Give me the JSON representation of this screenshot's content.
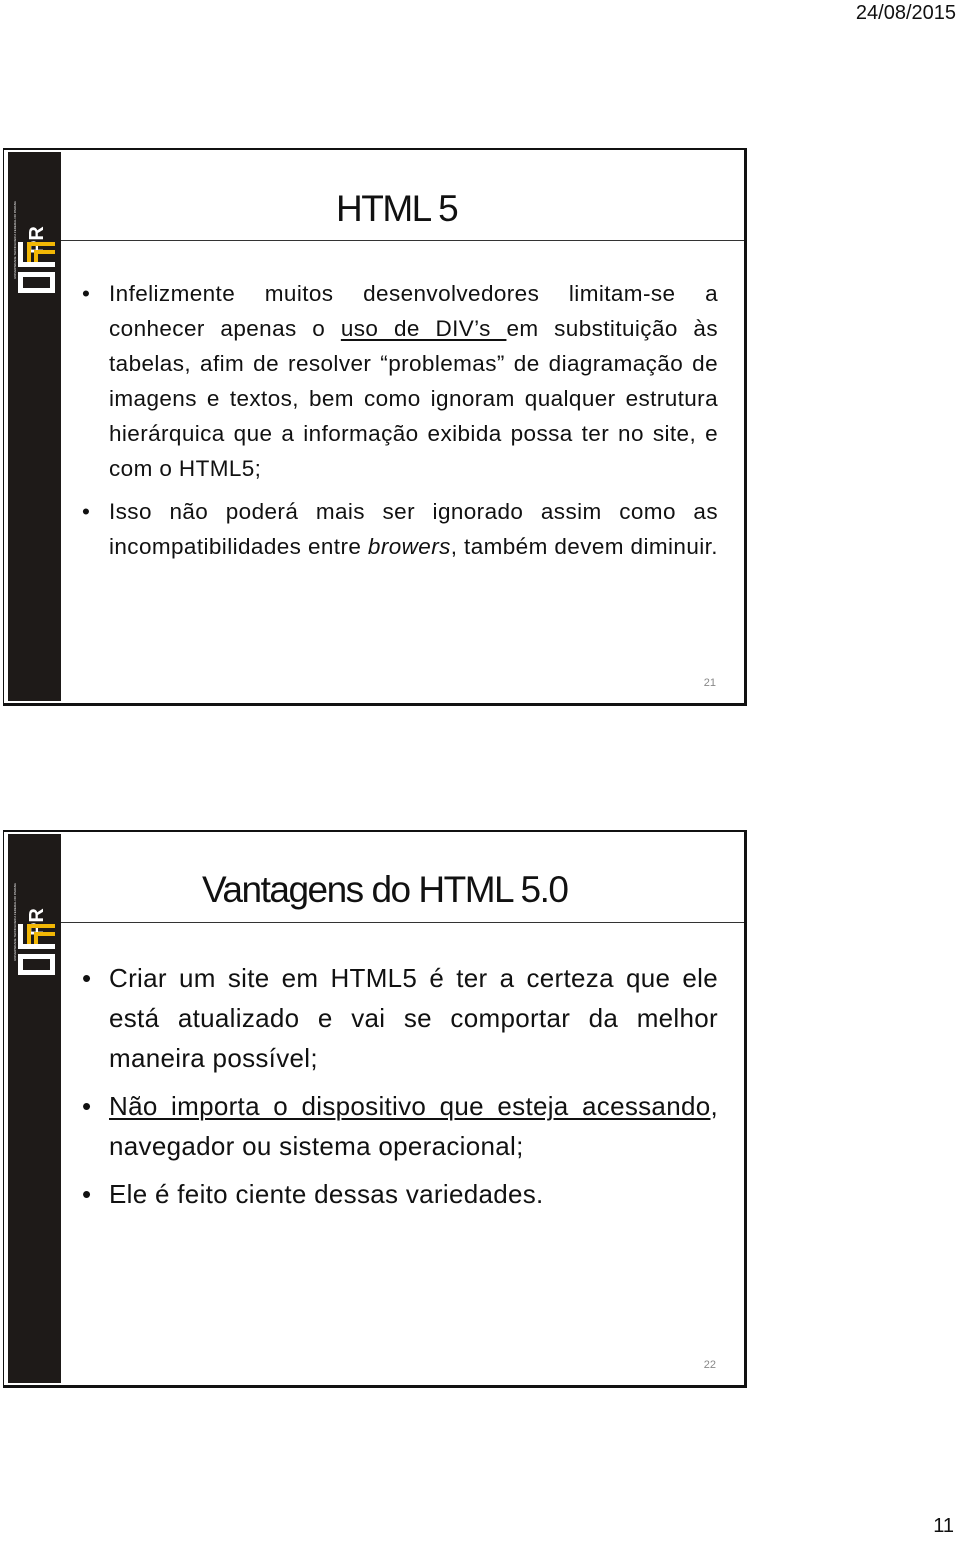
{
  "page": {
    "date": "24/08/2015",
    "page_number": "11"
  },
  "brand": {
    "logo_text": "UTFPR",
    "logo_subtext": "UNIVERSIDADE TECNOLÓGICA FEDERAL DO PARANÁ",
    "sidebar_color": "#1e1a18",
    "accent_color": "#f2b705"
  },
  "slides": [
    {
      "number": "21",
      "title": "HTML 5",
      "bullets": [
        {
          "parts": [
            {
              "text": " Infelizmente muitos desenvolvedores limitam-se a conhecer apenas o ",
              "style": "normal"
            },
            {
              "text": "uso de DIV’s ",
              "style": "underline"
            },
            {
              "text": "em substituição às tabelas, afim de resolver “problemas” de diagramação de imagens e textos, bem como ignoram qualquer estrutura hierárquica que a informação exibida possa ter no site, e com o HTML5;",
              "style": "normal"
            }
          ]
        },
        {
          "parts": [
            {
              "text": "Isso não poderá mais ser ignorado assim como as incompatibilidades entre ",
              "style": "normal"
            },
            {
              "text": "browers",
              "style": "italic"
            },
            {
              "text": ", também devem diminuir.",
              "style": "normal"
            }
          ]
        }
      ]
    },
    {
      "number": "22",
      "title": "Vantagens do HTML 5.0",
      "bullets": [
        {
          "parts": [
            {
              "text": "Criar um site em HTML5 é ter a certeza que ele está atualizado e vai se comportar da melhor maneira possível;",
              "style": "normal"
            }
          ]
        },
        {
          "parts": [
            {
              "text": "Não importa o dispositivo que esteja acessando",
              "style": "underline"
            },
            {
              "text": ", navegador ou sistema operacional;",
              "style": "normal"
            }
          ]
        },
        {
          "parts": [
            {
              "text": "Ele é feito ciente dessas variedades.",
              "style": "normal"
            }
          ]
        }
      ]
    }
  ]
}
